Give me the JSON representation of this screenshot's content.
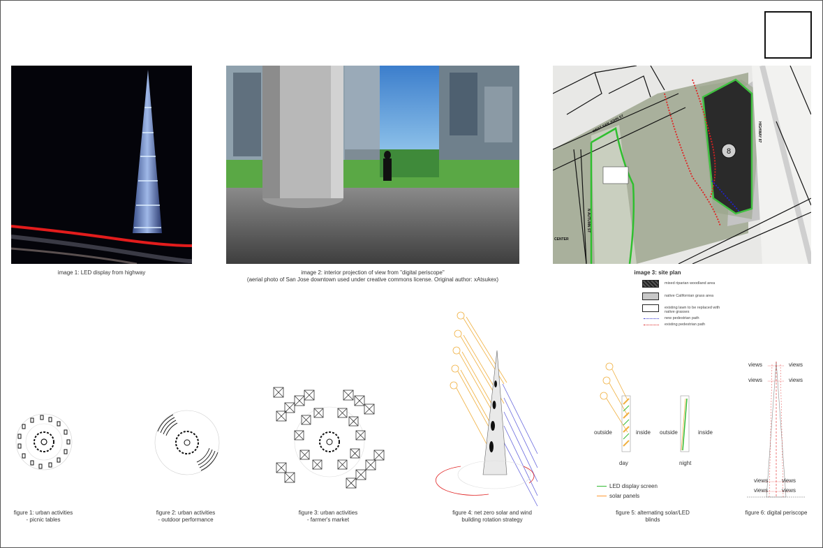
{
  "images": {
    "image1": {
      "caption": "image 1: LED display from highway"
    },
    "image2": {
      "caption_line1": "image 2: interior projection of view from \"digital periscope\"",
      "caption_line2": "(aerial photo of San Jose downtown used under creative commons license. Original author: xAtsukex)"
    },
    "image3": {
      "caption": "image 3: site plan",
      "street_west_san_john": "WEST SAN JOHN ST",
      "street_highway": "HIGHWAY 87",
      "street_autumn": "N AUTUMN ST",
      "label_center": "CENTER"
    }
  },
  "legend": {
    "items": [
      {
        "label": "mixed riparian woodland area"
      },
      {
        "label": "native Californian grass area"
      },
      {
        "label": "existing lawn to be replaced with native grasses"
      },
      {
        "label": "new pedestrian path",
        "color": "#3333cc"
      },
      {
        "label": "existing pedestrian path",
        "color": "#dd2222"
      }
    ]
  },
  "figures": {
    "fig1": {
      "line1": "figure 1: urban activities",
      "line2": "- picnic tables"
    },
    "fig2": {
      "line1": "figure 2: urban activities",
      "line2": "- outdoor performance"
    },
    "fig3": {
      "line1": "figure 3: urban activities",
      "line2": "- farmer's market"
    },
    "fig4": {
      "line1": "figure 4: net zero solar and wind",
      "line2": "building rotation strategy"
    },
    "fig5": {
      "line1": "figure 5: alternating solar/LED",
      "line2": "blinds",
      "outside": "outside",
      "inside": "inside",
      "day": "day",
      "night": "night",
      "legend_led": "LED display screen",
      "legend_solar": "solar panels",
      "led_color": "#33bb33",
      "solar_color": "#ff9933"
    },
    "fig6": {
      "line1": "figure 6: digital periscope",
      "views": "views"
    }
  }
}
